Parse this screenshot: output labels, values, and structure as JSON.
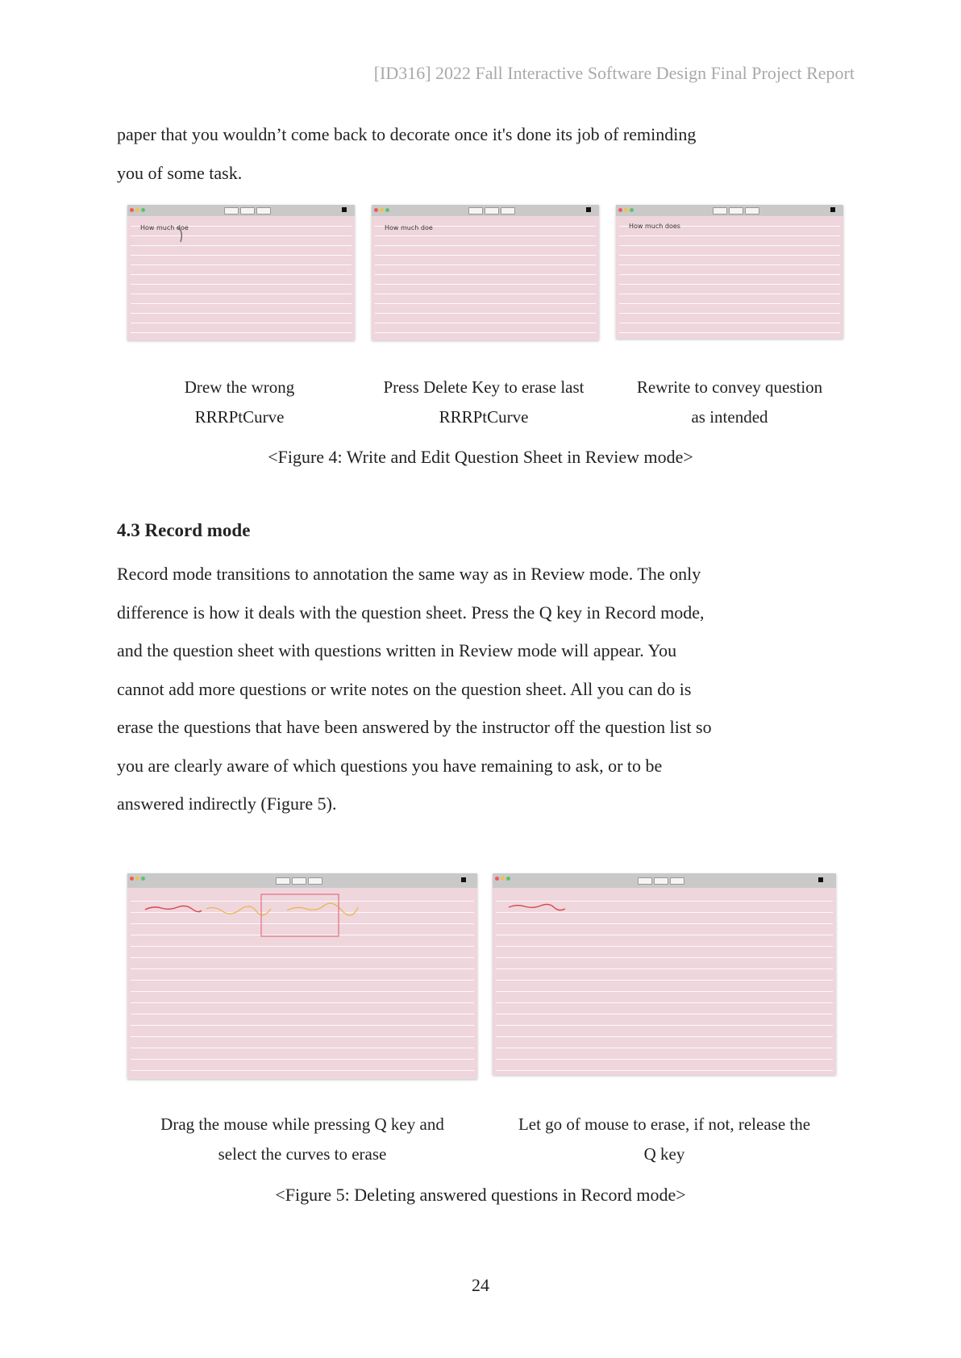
{
  "header": {
    "running_title": "[ID316] 2022 Fall Interactive Software Design Final Project Report"
  },
  "intro_paragraph": {
    "line1": "paper that you wouldn’t come back to decorate once it's done its job of reminding",
    "line2": "you of some task."
  },
  "figure4": {
    "screenshots": [
      {
        "handwriting": "How much doe"
      },
      {
        "handwriting": "How much doe"
      },
      {
        "handwriting": "How much does"
      }
    ],
    "captions": [
      {
        "line1": "Drew the wrong",
        "line2": "RRRPtCurve"
      },
      {
        "line1": "Press Delete Key to erase last",
        "line2": "RRRPtCurve"
      },
      {
        "line1": "Rewrite to convey question",
        "line2": "as intended"
      }
    ],
    "title": "<Figure 4: Write and Edit Question Sheet in Review mode>"
  },
  "section": {
    "heading": "4.3 Record mode",
    "lines": [
      "Record mode transitions to annotation the same way as in Review mode. The only",
      "difference is how it deals with the question sheet. Press the Q key in Record mode,",
      "and the question sheet with questions written in Review mode will appear. You",
      "cannot add more questions or write notes on the question sheet. All you can do is",
      "erase the questions that have been answered by the instructor off the question list so",
      "you are clearly aware of which questions you have remaining to ask, or to be",
      "answered indirectly (Figure 5)."
    ]
  },
  "figure5": {
    "captions": [
      {
        "line1": "Drag the mouse while pressing Q key and",
        "line2": "select the curves to erase"
      },
      {
        "line1": "Let go of mouse to erase, if not, release the",
        "line2": "Q key"
      }
    ],
    "title": "<Figure 5: Deleting answered questions in Record mode>"
  },
  "footer": {
    "page_number": "24"
  },
  "colors": {
    "sheet_pink": "#efd6dc",
    "titlebar_gray": "#c9c9c9",
    "ink_red": "#d9434f",
    "ink_yellow": "#e8b54a",
    "selection_box": "#e5707e"
  }
}
